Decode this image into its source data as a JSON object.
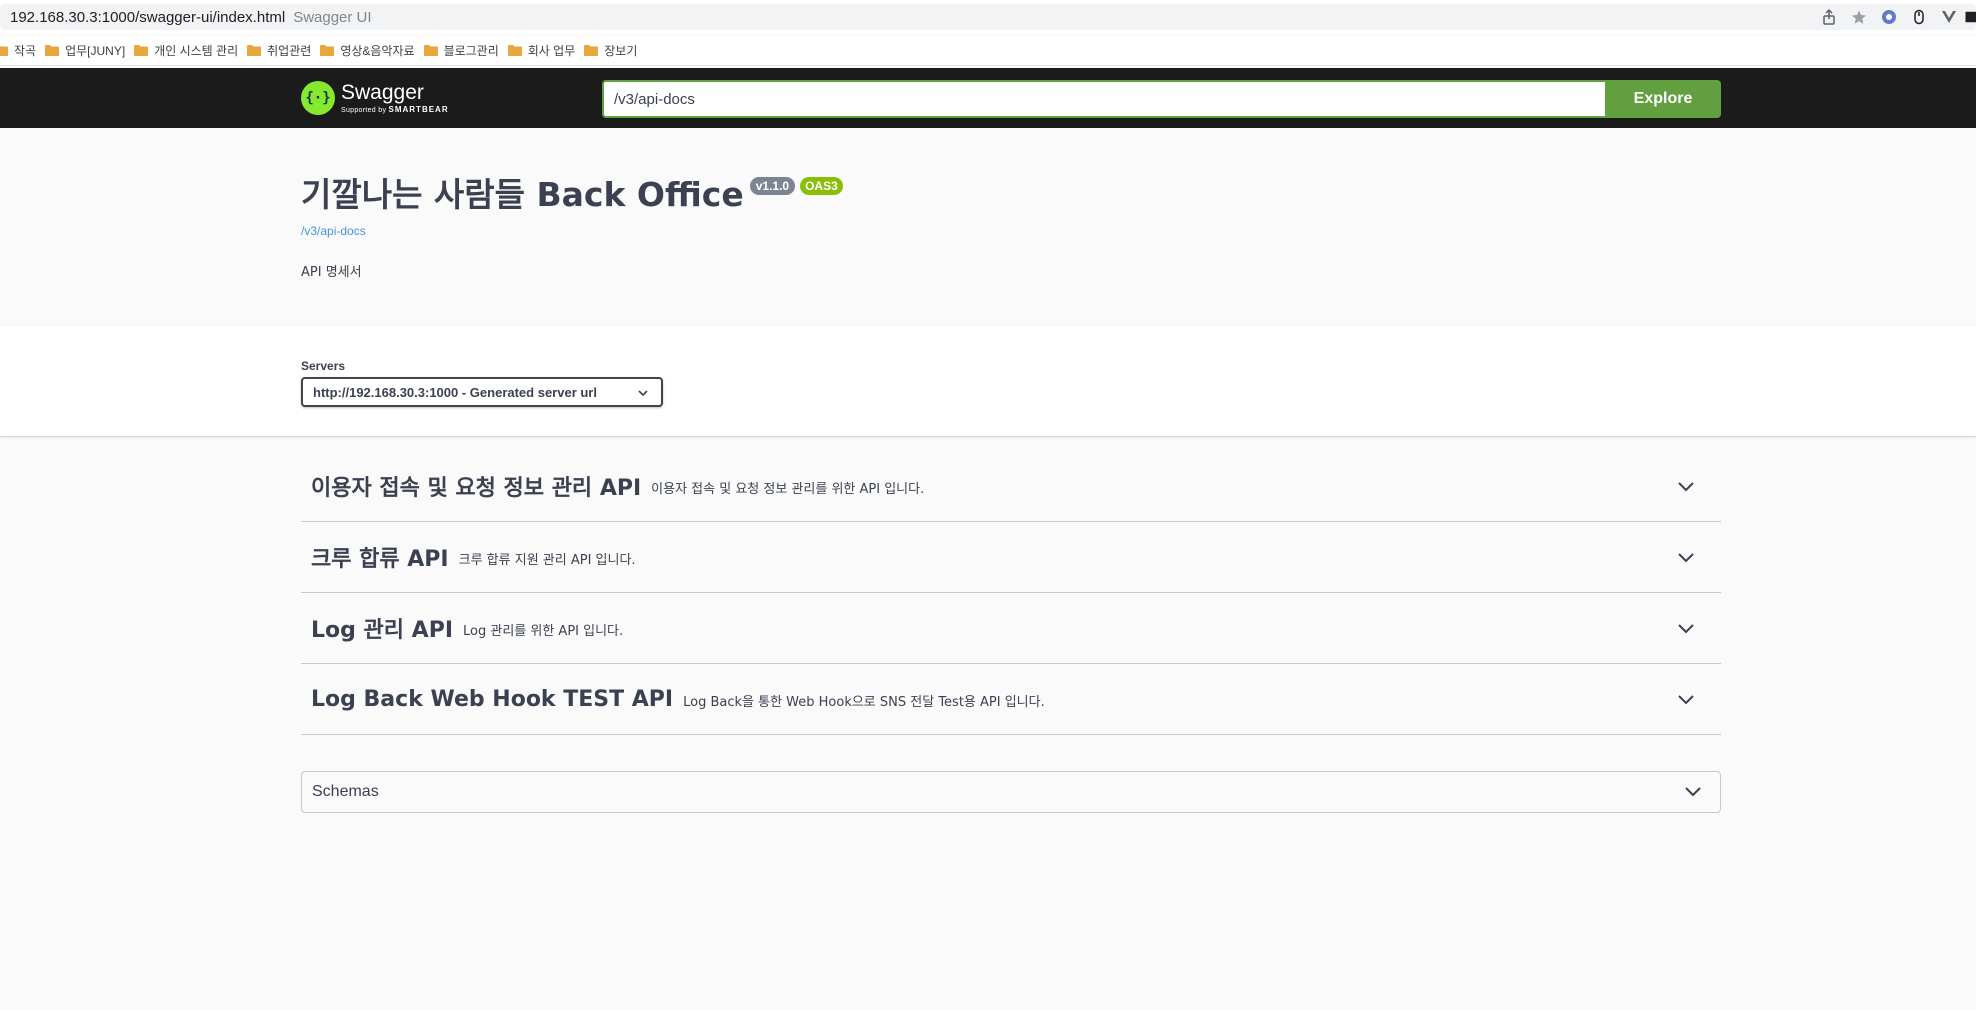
{
  "browser": {
    "url": "192.168.30.3:1000/swagger-ui/index.html",
    "page_title": "Swagger UI"
  },
  "bookmarks": [
    {
      "label": "작곡"
    },
    {
      "label": "업무[JUNY]"
    },
    {
      "label": "개인 시스템 관리"
    },
    {
      "label": "취업관련"
    },
    {
      "label": "영상&음악자료"
    },
    {
      "label": "블로그관리"
    },
    {
      "label": "회사 업무"
    },
    {
      "label": "장보기"
    }
  ],
  "topbar": {
    "logo_name": "Swagger",
    "logo_supported": "Supported by",
    "logo_brand": "SMARTBEAR",
    "spec_url": "/v3/api-docs",
    "explore_label": "Explore"
  },
  "info": {
    "title": "기깔나는 사람들 Back Office",
    "version": "v1.1.0",
    "oas": "OAS3",
    "spec_link": "/v3/api-docs",
    "description": "API 명세서"
  },
  "servers": {
    "label": "Servers",
    "selected": "http://192.168.30.3:1000 - Generated server url"
  },
  "tags": [
    {
      "name": "이용자 접속 및 요청 정보 관리 API",
      "description": "이용자 접속 및 요청 정보 관리를 위한 API 입니다."
    },
    {
      "name": "크루 합류 API",
      "description": "크루 합류 지원 관리 API 입니다."
    },
    {
      "name": "Log 관리 API",
      "description": "Log 관리를 위한 API 입니다."
    },
    {
      "name": "Log Back Web Hook TEST API",
      "description": "Log Back을 통한 Web Hook으로 SNS 전달 Test용 API 입니다."
    }
  ],
  "schemas": {
    "title": "Schemas"
  },
  "colors": {
    "topbar_bg": "#1b1b1b",
    "explore_green": "#62a03f",
    "logo_green": "#85ea2d",
    "version_badge": "#7d8492",
    "oas_badge": "#89bf04",
    "link_blue": "#4990e2",
    "text": "#3b4151"
  }
}
